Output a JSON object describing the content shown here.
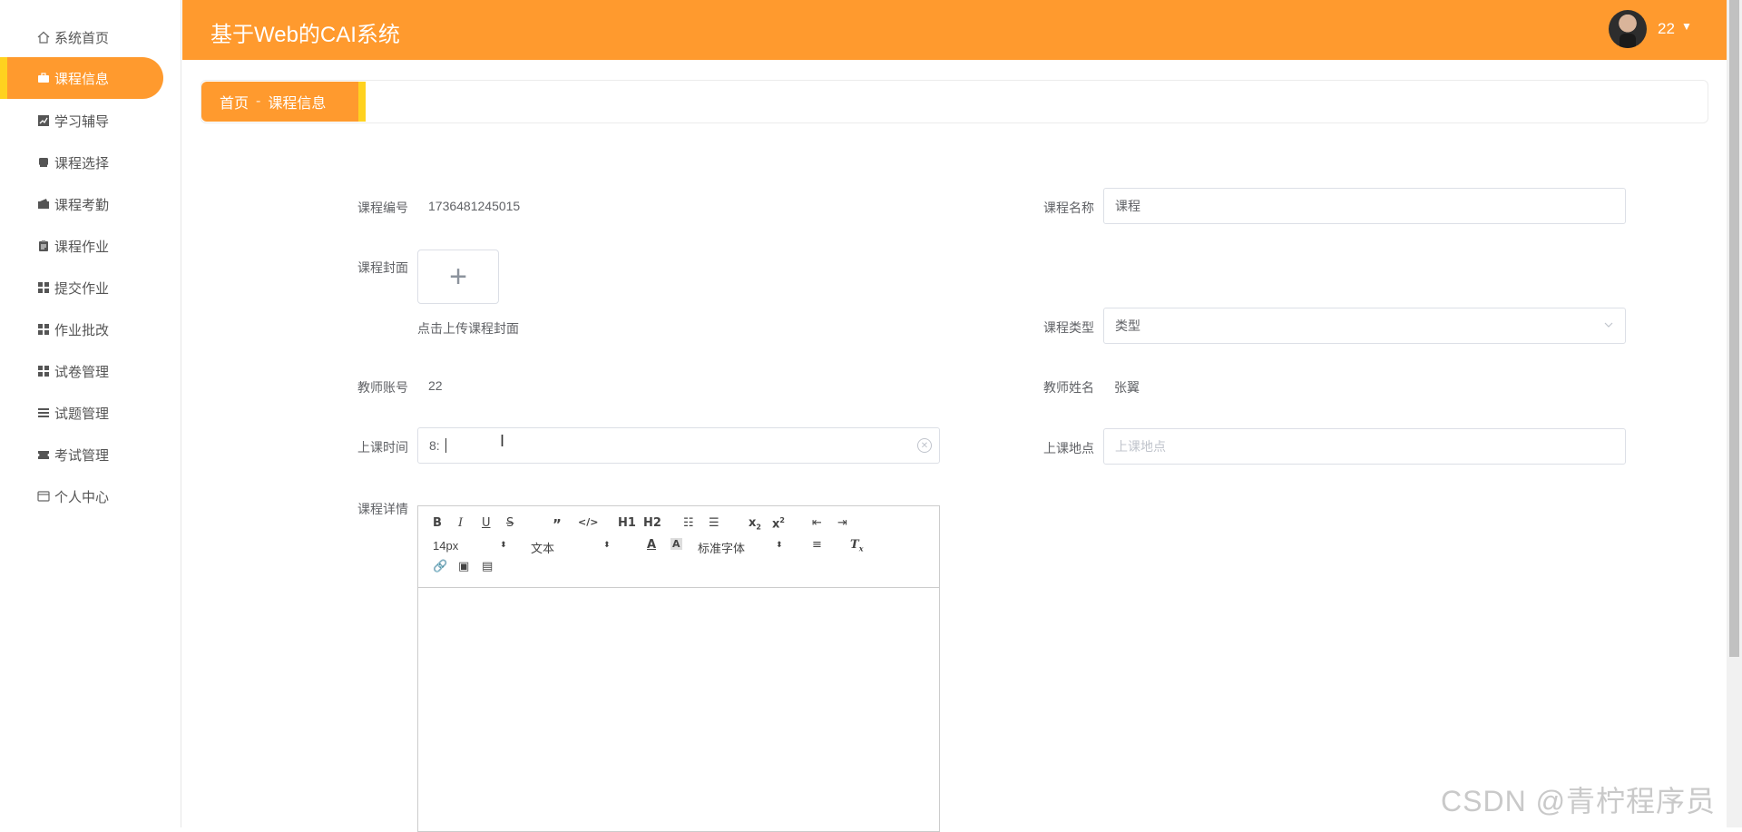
{
  "app": {
    "title": "基于Web的CAI系统"
  },
  "user": {
    "name": "22"
  },
  "sidebar": {
    "items": [
      {
        "label": "系统首页",
        "icon": "home-icon"
      },
      {
        "label": "课程信息",
        "icon": "briefcase-icon",
        "active": true
      },
      {
        "label": "学习辅导",
        "icon": "chart-icon"
      },
      {
        "label": "课程选择",
        "icon": "bookmark-icon"
      },
      {
        "label": "课程考勤",
        "icon": "wallet-icon"
      },
      {
        "label": "课程作业",
        "icon": "clipboard-icon"
      },
      {
        "label": "提交作业",
        "icon": "grid-icon"
      },
      {
        "label": "作业批改",
        "icon": "grid-icon"
      },
      {
        "label": "试卷管理",
        "icon": "grid-icon"
      },
      {
        "label": "试题管理",
        "icon": "list-icon"
      },
      {
        "label": "考试管理",
        "icon": "ticket-icon"
      },
      {
        "label": "个人中心",
        "icon": "card-icon"
      }
    ]
  },
  "breadcrumb": {
    "home": "首页",
    "separator": "-",
    "current": "课程信息"
  },
  "form": {
    "course_no": {
      "label": "课程编号",
      "value": "1736481245015"
    },
    "course_name": {
      "label": "课程名称",
      "value": "课程"
    },
    "cover": {
      "label": "课程封面",
      "tip": "点击上传课程封面",
      "plus": "+"
    },
    "course_type": {
      "label": "课程类型",
      "value": "类型"
    },
    "teacher_no": {
      "label": "教师账号",
      "value": "22"
    },
    "teacher_name": {
      "label": "教师姓名",
      "value": "张翼"
    },
    "class_time": {
      "label": "上课时间",
      "value": "8:"
    },
    "class_place": {
      "label": "上课地点",
      "placeholder": "上课地点"
    },
    "details": {
      "label": "课程详情"
    }
  },
  "editor": {
    "font_size": "14px",
    "header_select": "文本",
    "font_family": "标准字体",
    "h1": "H1",
    "h2": "H2"
  },
  "watermark": "CSDN @青柠程序员",
  "colors": {
    "accent": "#ff9a2e",
    "accent_bar": "#ffd21f"
  }
}
